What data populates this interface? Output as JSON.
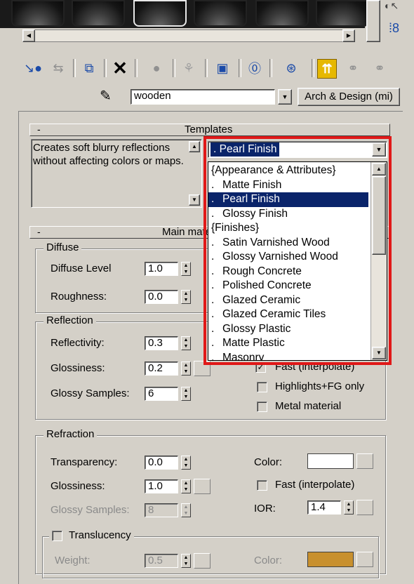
{
  "material_name": "wooden",
  "material_type": "Arch & Design (mi)",
  "templates": {
    "rollout_title": "Templates",
    "collapse_symbol": "-",
    "description": "Creates soft blurry reflections without affecting colors or maps.",
    "selected": ". Pearl Finish",
    "dropdown_items": [
      {
        "text": "{Appearance & Attributes}",
        "prefix": "",
        "selected": false
      },
      {
        "text": "Matte Finish",
        "prefix": ".",
        "selected": false
      },
      {
        "text": "Pearl Finish",
        "prefix": ".",
        "selected": true
      },
      {
        "text": "Glossy Finish",
        "prefix": ".",
        "selected": false
      },
      {
        "text": "{Finishes}",
        "prefix": "",
        "selected": false
      },
      {
        "text": "Satin Varnished Wood",
        "prefix": ".",
        "selected": false
      },
      {
        "text": "Glossy Varnished Wood",
        "prefix": ".",
        "selected": false
      },
      {
        "text": "Rough Concrete",
        "prefix": ".",
        "selected": false
      },
      {
        "text": "Polished Concrete",
        "prefix": ".",
        "selected": false
      },
      {
        "text": "Glazed Ceramic",
        "prefix": ".",
        "selected": false
      },
      {
        "text": "Glazed Ceramic Tiles",
        "prefix": ".",
        "selected": false
      },
      {
        "text": "Glossy Plastic",
        "prefix": ".",
        "selected": false
      },
      {
        "text": "Matte Plastic",
        "prefix": ".",
        "selected": false
      },
      {
        "text": "Masonry",
        "prefix": ".",
        "selected": false
      }
    ]
  },
  "main": {
    "rollout_title": "Main materi",
    "collapse_symbol": "-",
    "diffuse": {
      "title": "Diffuse",
      "level_label": "Diffuse Level",
      "level_value": "1.0",
      "roughness_label": "Roughness:",
      "roughness_value": "0.0"
    },
    "reflection": {
      "title": "Reflection",
      "reflectivity_label": "Reflectivity:",
      "reflectivity_value": "0.3",
      "glossiness_label": "Glossiness:",
      "glossiness_value": "0.2",
      "samples_label": "Glossy Samples:",
      "samples_value": "6",
      "fast_label": "Fast (interpolate)",
      "highlights_label": "Highlights+FG only",
      "metal_label": "Metal material"
    },
    "refraction": {
      "title": "Refraction",
      "transparency_label": "Transparency:",
      "transparency_value": "0.0",
      "glossiness_label": "Glossiness:",
      "glossiness_value": "1.0",
      "samples_label": "Glossy Samples:",
      "samples_value": "8",
      "color_label": "Color:",
      "color_value": "#ffffff",
      "fast_label": "Fast (interpolate)",
      "ior_label": "IOR:",
      "ior_value": "1.4"
    },
    "translucency": {
      "title": "Translucency",
      "weight_label": "Weight:",
      "weight_value": "0.5",
      "color_label": "Color:",
      "color_value": "#c8902e"
    }
  },
  "colors": {
    "highlight_box": "#e01818",
    "selection": "#0a246a"
  }
}
